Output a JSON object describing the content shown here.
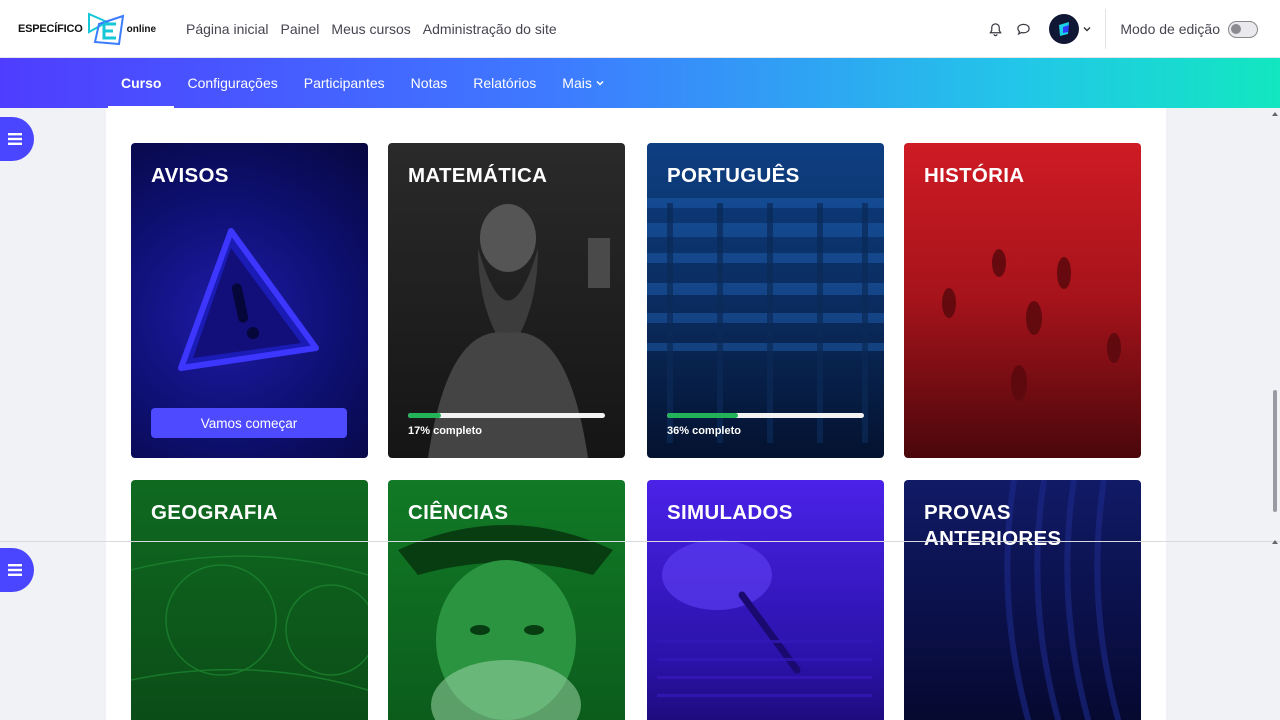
{
  "brand": {
    "name": "ESPECÍFICO",
    "suffix": "online"
  },
  "primary_nav": [
    "Página inicial",
    "Painel",
    "Meus cursos",
    "Administração do site"
  ],
  "user_menu": {
    "edit_mode_label": "Modo de edição",
    "edit_mode_on": false
  },
  "secondary_nav": {
    "items": [
      "Curso",
      "Configurações",
      "Participantes",
      "Notas",
      "Relatórios"
    ],
    "more_label": "Mais",
    "active": "Curso"
  },
  "cards": [
    {
      "title": "AVISOS",
      "button_label": "Vamos começar",
      "theme": "#0d0f6e"
    },
    {
      "title": "MATEMÁTICA",
      "progress": 0.17,
      "progress_label": "17% completo",
      "theme": "#1c1c1c"
    },
    {
      "title": "PORTUGUÊS",
      "progress": 0.36,
      "progress_label": "36% completo",
      "theme": "#0b2f66"
    },
    {
      "title": "HISTÓRIA",
      "theme": "#a5131b"
    },
    {
      "title": "GEOGRAFIA",
      "theme": "#0f5a1c"
    },
    {
      "title": "CIÊNCIAS",
      "theme": "#0e5f1e"
    },
    {
      "title": "SIMULADOS",
      "theme": "#3a1bd0"
    },
    {
      "title": "PROVAS ANTERIORES",
      "theme": "#0a0f45"
    }
  ],
  "colors": {
    "accent": "#4e4aff",
    "progress": "#23b45a",
    "gradient_start": "#4f3dff",
    "gradient_end": "#12e7c0"
  },
  "icons": [
    "bell-icon",
    "chat-icon",
    "avatar-icon",
    "chevron-down-icon",
    "list-icon",
    "warning-icon"
  ]
}
